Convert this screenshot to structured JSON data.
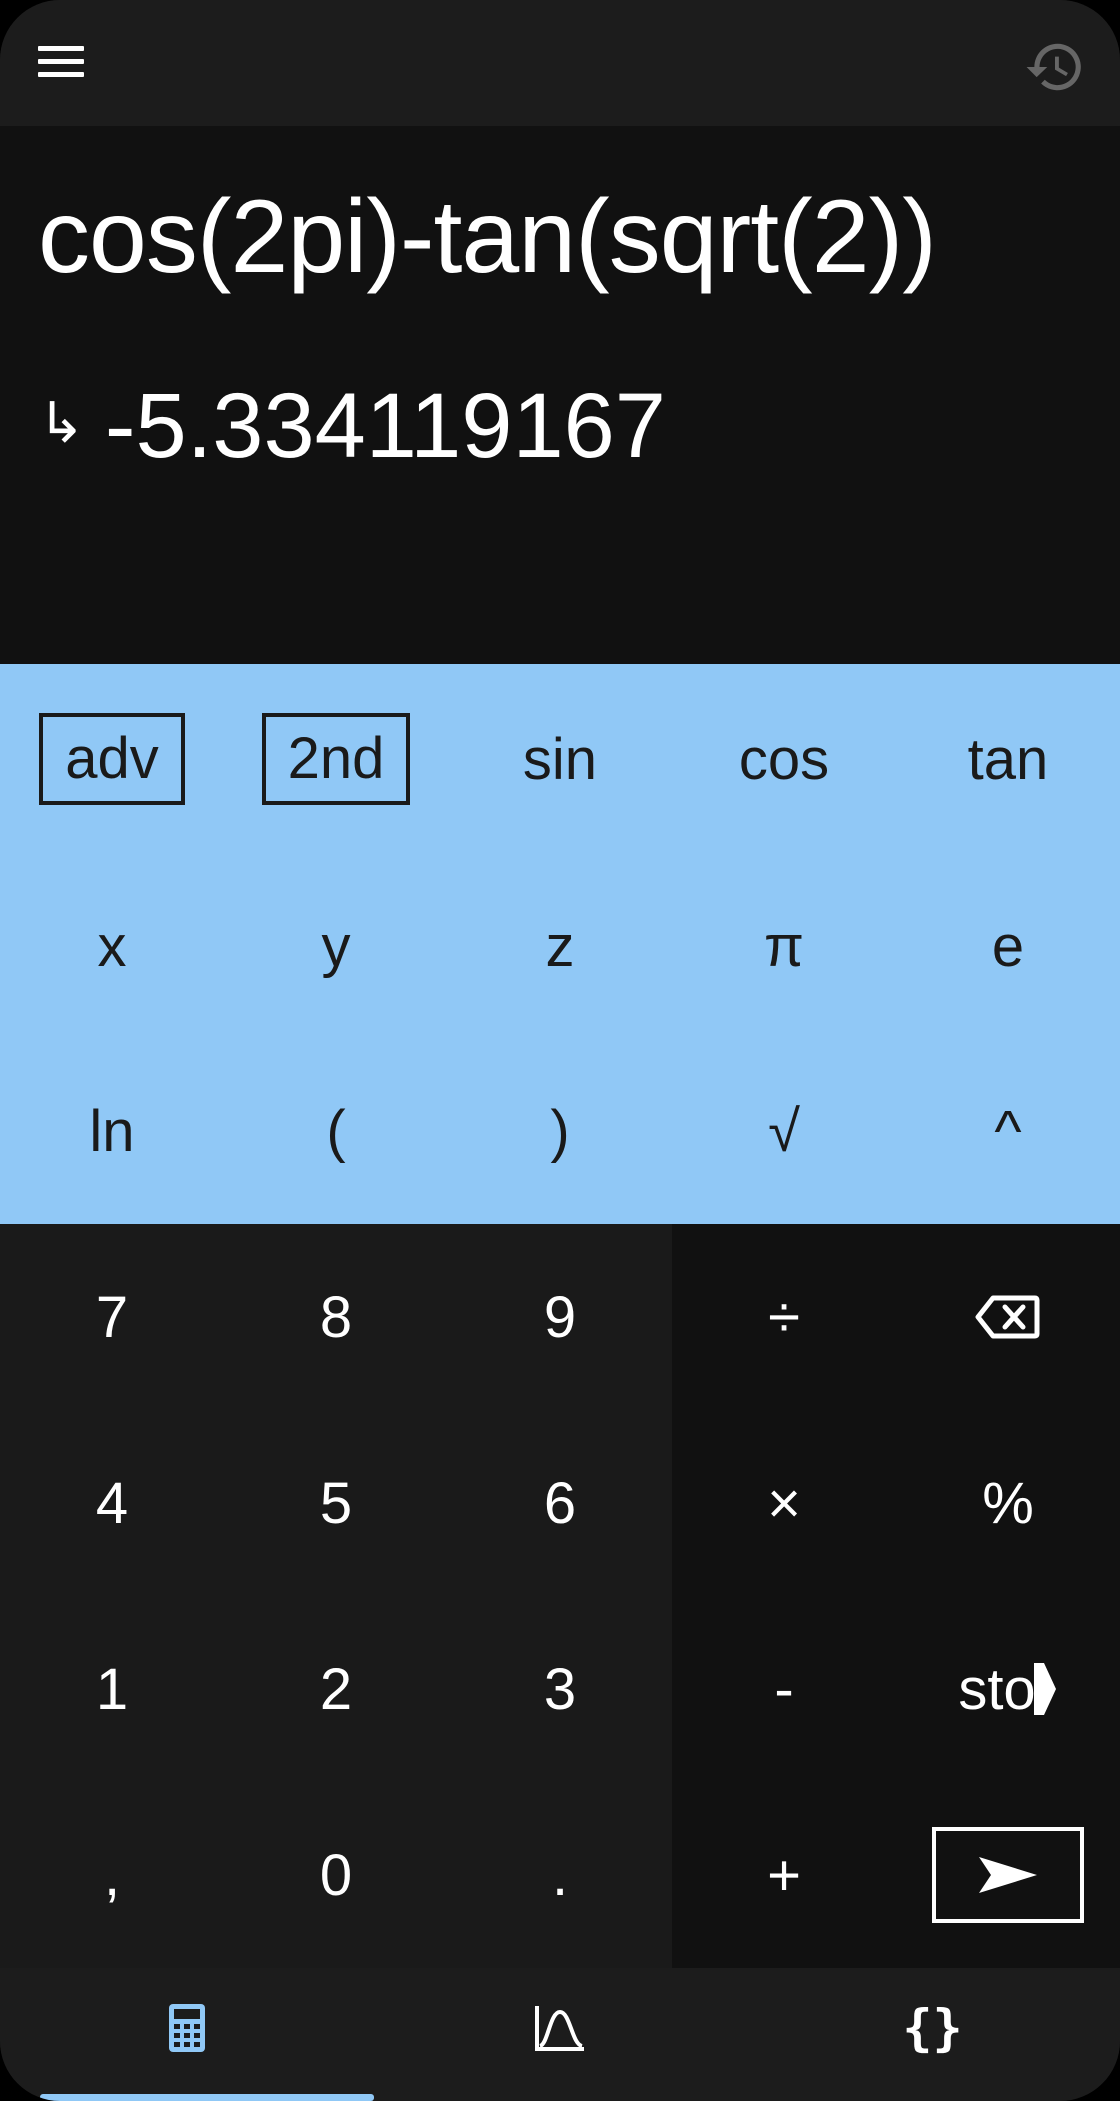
{
  "display": {
    "expression": "cos(2pi)-tan(sqrt(2))",
    "result_prefix": "↳",
    "result": "-5.334119167"
  },
  "advanced_pad": {
    "rows": [
      [
        "adv",
        "2nd",
        "sin",
        "cos",
        "tan"
      ],
      [
        "x",
        "y",
        "z",
        "π",
        "e"
      ],
      [
        "ln",
        "(",
        ")",
        "√",
        "^"
      ]
    ]
  },
  "number_pad": {
    "rows": [
      [
        "7",
        "8",
        "9"
      ],
      [
        "4",
        "5",
        "6"
      ],
      [
        "1",
        "2",
        "3"
      ],
      [
        ",",
        "0",
        "."
      ]
    ]
  },
  "operator_pad": {
    "divide": "÷",
    "multiply": "×",
    "subtract": "-",
    "add": "+",
    "percent": "%",
    "store": "sto"
  },
  "icons": {
    "menu": "menu-icon",
    "history": "history-icon",
    "backspace": "backspace-icon",
    "enter": "enter-arrow-icon",
    "calculator": "calculator-icon",
    "graph": "graph-icon",
    "program": "braces-icon"
  },
  "bottom_nav": {
    "program_label": "{}"
  },
  "colors": {
    "accent": "#90c8f6",
    "topbar": "#1c1c1c",
    "display_bg": "#111111",
    "numpad_bg": "#1a1a1a"
  }
}
